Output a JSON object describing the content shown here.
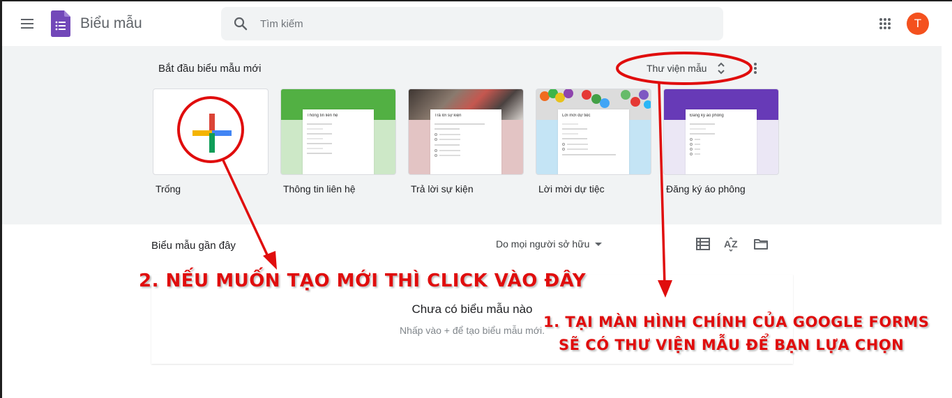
{
  "header": {
    "app_title": "Biểu mẫu",
    "search_placeholder": "Tìm kiếm",
    "avatar_initial": "T",
    "brand_color": "#673ab7",
    "avatar_color": "#f4511e"
  },
  "gallery": {
    "title": "Bắt đầu biểu mẫu mới",
    "toggle_label": "Thư viện mẫu",
    "templates": [
      {
        "label": "Trống",
        "preview_title": ""
      },
      {
        "label": "Thông tin liên hệ",
        "preview_title": "Thông tin liên hệ",
        "banner_color": "#52b043",
        "body_color": "#cde8c7"
      },
      {
        "label": "Trả lời sự kiện",
        "preview_title": "Trả lời sự kiện",
        "banner_color": "#5a4a44",
        "body_color": "#e3c4c4"
      },
      {
        "label": "Lời mời dự tiệc",
        "preview_title": "Lời mời dự tiệc",
        "banner_color": "#d6d6d6",
        "body_color": "#c4e4f5"
      },
      {
        "label": "Đăng ký áo phông",
        "preview_title": "Đăng ký áo phông",
        "banner_color": "#673ab7",
        "body_color": "#ebe7f5"
      }
    ]
  },
  "recent": {
    "title": "Biểu mẫu gần đây",
    "owner_filter": "Do mọi người sở hữu",
    "empty_title": "Chưa có biểu mẫu nào",
    "empty_subtitle": "Nhấp vào + để tạo biểu mẫu mới."
  },
  "annotations": {
    "note_2": "2. NẾU MUỐN TẠO MỚI THÌ CLICK VÀO ĐÂY",
    "note_1_line1": "1. TẠI MÀN HÌNH CHÍNH CỦA GOOGLE FORMS",
    "note_1_line2": "SẼ CÓ THƯ VIỆN MẪU ĐỂ BẠN LỰA CHỌN",
    "color": "#e00d0d"
  }
}
